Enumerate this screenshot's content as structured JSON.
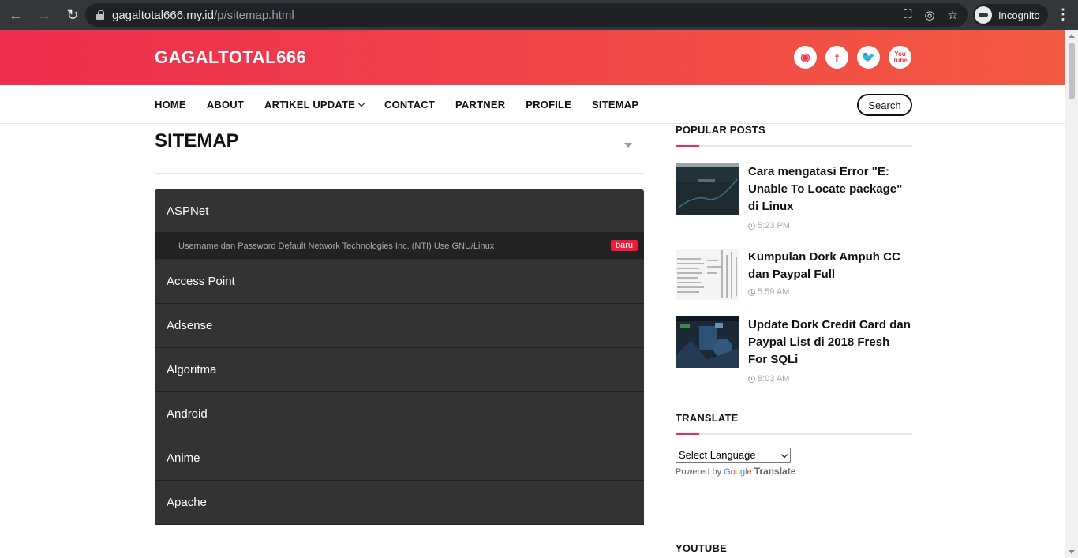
{
  "browser": {
    "url_host": "gagaltotal666.my.id",
    "url_path": "/p/sitemap.html",
    "incognito_label": "Incognito"
  },
  "header": {
    "site_title": "GAGALTOTAL666",
    "social": [
      {
        "name": "github",
        "glyph": "◉"
      },
      {
        "name": "facebook",
        "glyph": "f"
      },
      {
        "name": "twitter",
        "glyph": "🐦"
      },
      {
        "name": "youtube",
        "glyph": "You Tube"
      }
    ]
  },
  "nav": {
    "items": [
      "HOME",
      "ABOUT",
      "ARTIKEL UPDATE",
      "CONTACT",
      "PARTNER",
      "PROFILE",
      "SITEMAP"
    ],
    "search_label": "Search"
  },
  "main": {
    "title": "SITEMAP",
    "categories": [
      {
        "label": "ASPNet",
        "post": "Username dan Password Default Network Technologies Inc. (NTI) Use GNU/Linux",
        "badge": "baru"
      },
      {
        "label": "Access Point"
      },
      {
        "label": "Adsense"
      },
      {
        "label": "Algoritma"
      },
      {
        "label": "Android"
      },
      {
        "label": "Anime"
      },
      {
        "label": "Apache"
      }
    ]
  },
  "sidebar": {
    "popular_title": "POPULAR POSTS",
    "posts": [
      {
        "title": "Cara mengatasi Error \"E: Unable To Locate package\" di Linux",
        "time": "5:23 PM"
      },
      {
        "title": "Kumpulan Dork Ampuh CC dan Paypal Full",
        "time": "5:59 AM"
      },
      {
        "title": "Update Dork Credit Card dan Paypal List di 2018 Fresh For SQLi",
        "time": "8:03 AM"
      }
    ],
    "translate_title": "TRANSLATE",
    "select_language": "Select Language",
    "powered_by": "Powered by",
    "translate_label": "Translate",
    "youtube_title": "YOUTUBE"
  },
  "colors": {
    "header_start": "#ee2d4f",
    "header_end": "#f25a42",
    "accent": "#ee2d4f",
    "badge": "#ed1c3a"
  }
}
